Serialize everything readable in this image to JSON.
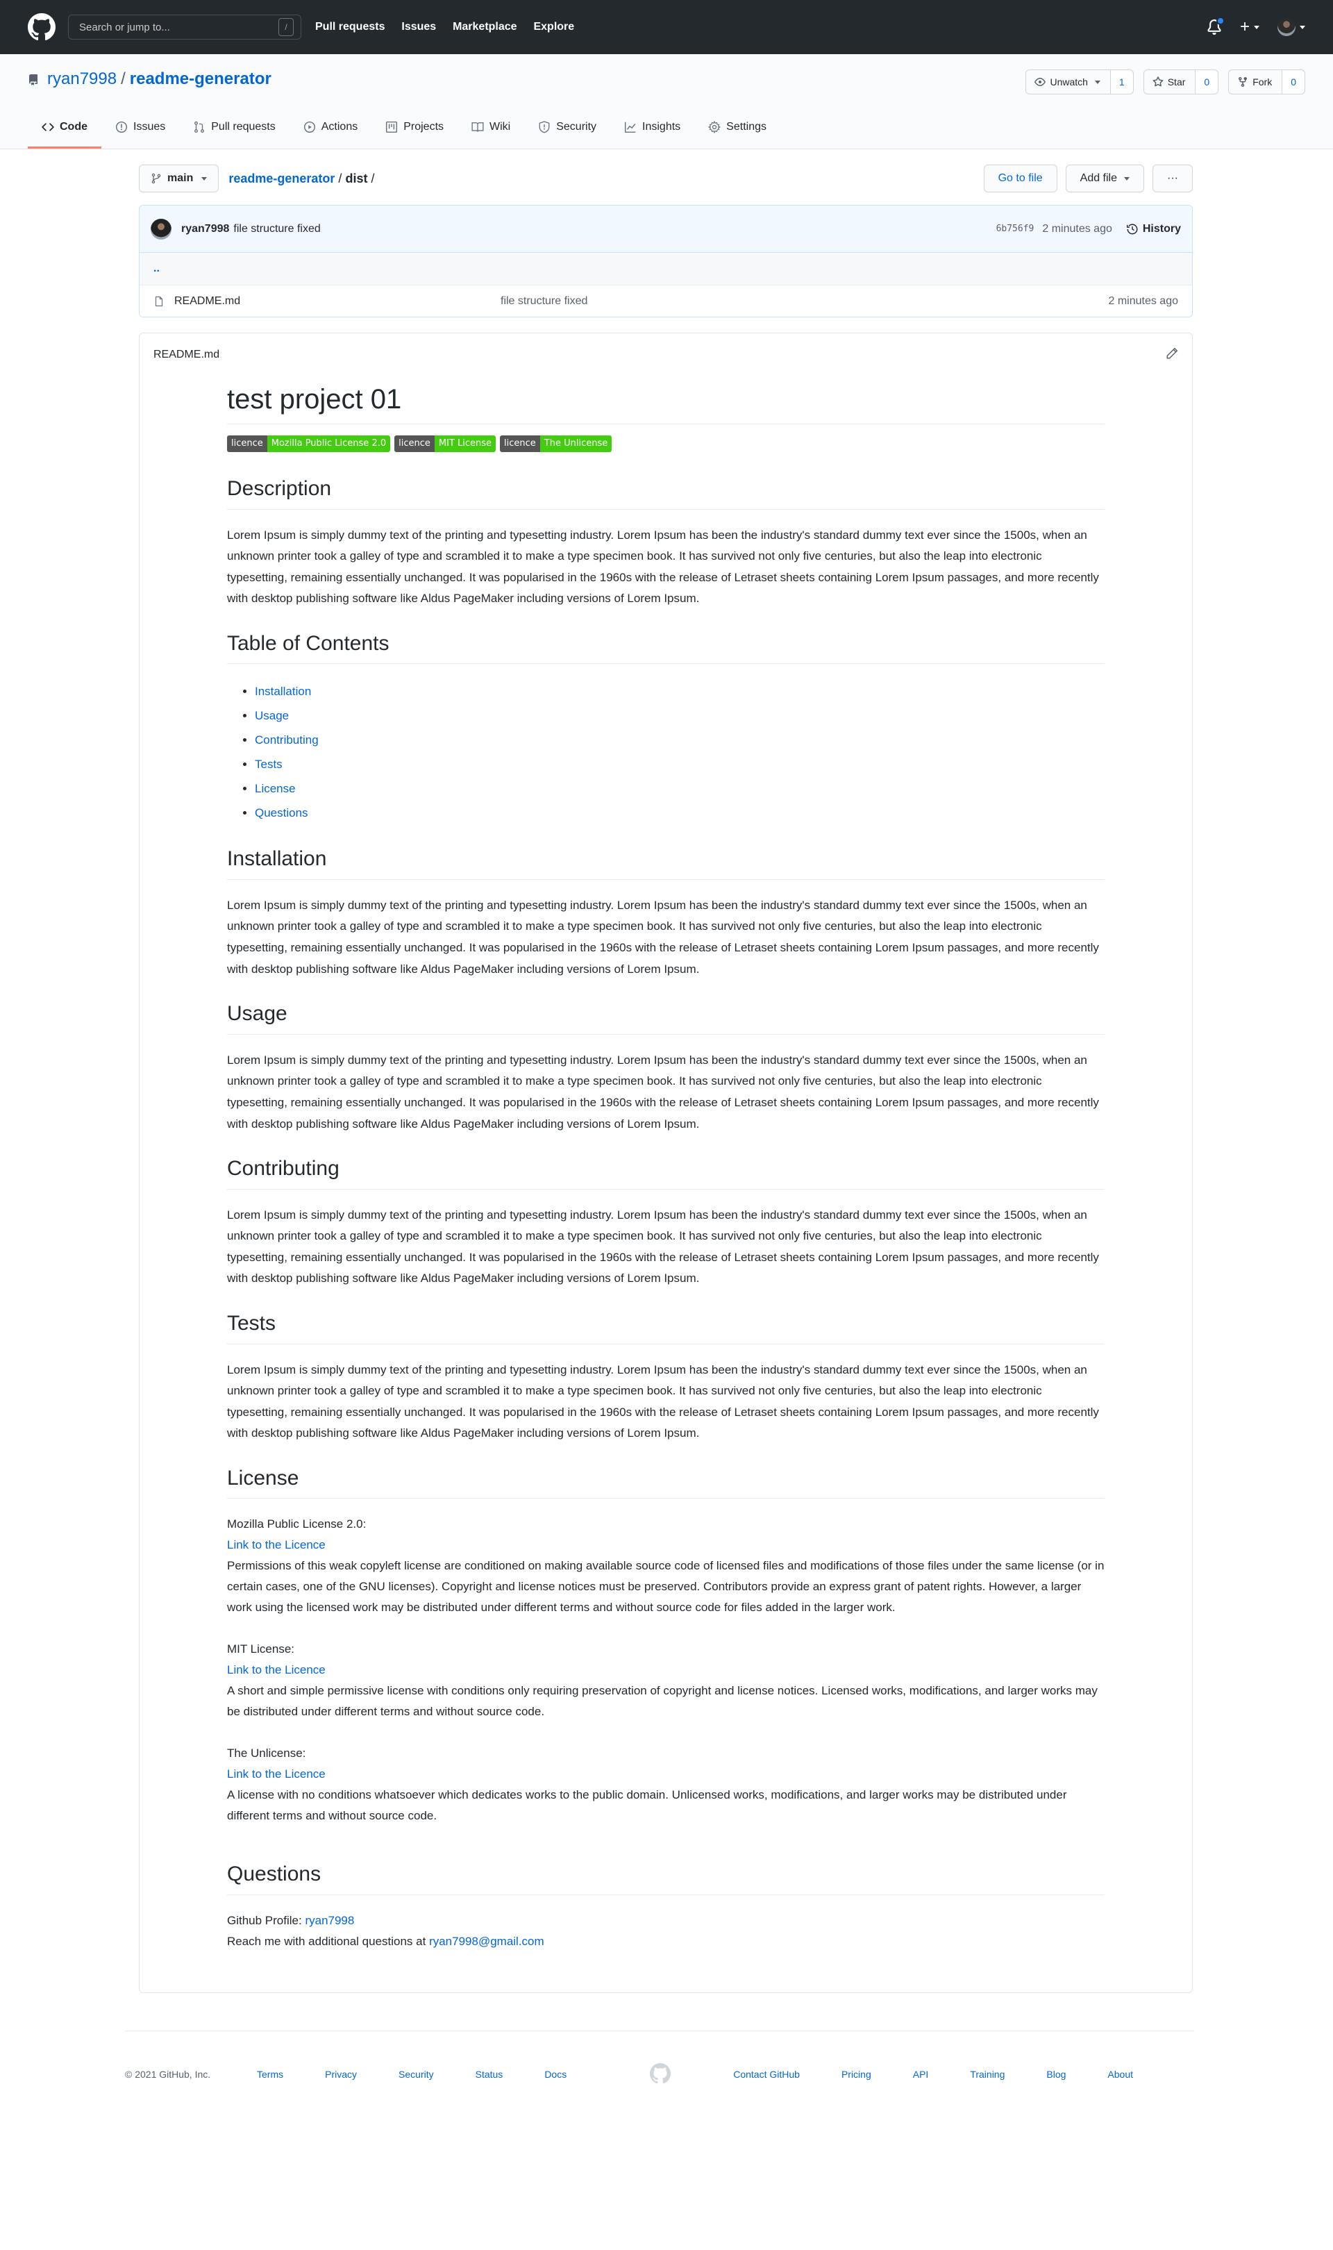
{
  "topbar": {
    "search_placeholder": "Search or jump to...",
    "search_shortcut": "/",
    "nav": [
      "Pull requests",
      "Issues",
      "Marketplace",
      "Explore"
    ]
  },
  "repo": {
    "owner": "ryan7998",
    "separator": "/",
    "name": "readme-generator",
    "watch": {
      "label": "Unwatch",
      "count": "1"
    },
    "star": {
      "label": "Star",
      "count": "0"
    },
    "fork": {
      "label": "Fork",
      "count": "0"
    },
    "tabs": [
      "Code",
      "Issues",
      "Pull requests",
      "Actions",
      "Projects",
      "Wiki",
      "Security",
      "Insights",
      "Settings"
    ],
    "active_tab": "Code"
  },
  "filenav": {
    "branch": "main",
    "crumb_repo": "readme-generator",
    "crumb_dir": "dist",
    "slash": "/",
    "go_to_file": "Go to file",
    "add_file": "Add file",
    "more": "···"
  },
  "commit": {
    "author": "ryan7998",
    "message": "file structure fixed",
    "sha": "6b756f9",
    "age": "2 minutes ago",
    "history": "History"
  },
  "files": {
    "up": "..",
    "rows": [
      {
        "name": "README.md",
        "message": "file structure fixed",
        "age": "2 minutes ago"
      }
    ]
  },
  "readme": {
    "filename": "README.md",
    "title": "test project 01",
    "badges": [
      {
        "label": "licence",
        "value": "Mozilla Public License 2.0"
      },
      {
        "label": "licence",
        "value": "MIT License"
      },
      {
        "label": "licence",
        "value": "The Unlicense"
      }
    ],
    "description_heading": "Description",
    "lorem": "Lorem Ipsum is simply dummy text of the printing and typesetting industry. Lorem Ipsum has been the industry's standard dummy text ever since the 1500s, when an unknown printer took a galley of type and scrambled it to make a type specimen book. It has survived not only five centuries, but also the leap into electronic typesetting, remaining essentially unchanged. It was popularised in the 1960s with the release of Letraset sheets containing Lorem Ipsum passages, and more recently with desktop publishing software like Aldus PageMaker including versions of Lorem Ipsum.",
    "toc_heading": "Table of Contents",
    "toc": [
      "Installation",
      "Usage",
      "Contributing",
      "Tests",
      "License",
      "Questions"
    ],
    "installation_heading": "Installation",
    "usage_heading": "Usage",
    "contributing_heading": "Contributing",
    "tests_heading": "Tests",
    "license_heading": "License",
    "licenses": [
      {
        "name": "Mozilla Public License 2.0:",
        "link": "Link to the Licence",
        "text": "Permissions of this weak copyleft license are conditioned on making available source code of licensed files and modifications of those files under the same license (or in certain cases, one of the GNU licenses). Copyright and license notices must be preserved. Contributors provide an express grant of patent rights. However, a larger work using the licensed work may be distributed under different terms and without source code for files added in the larger work."
      },
      {
        "name": "MIT License:",
        "link": "Link to the Licence",
        "text": "A short and simple permissive license with conditions only requiring preservation of copyright and license notices. Licensed works, modifications, and larger works may be distributed under different terms and without source code."
      },
      {
        "name": "The Unlicense:",
        "link": "Link to the Licence",
        "text": "A license with no conditions whatsoever which dedicates works to the public domain. Unlicensed works, modifications, and larger works may be distributed under different terms and without source code."
      }
    ],
    "questions_heading": "Questions",
    "profile_label": "Github Profile: ",
    "profile_link": "ryan7998",
    "reach_label": "Reach me with additional questions at ",
    "email": "ryan7998@gmail.com"
  },
  "footer": {
    "copyright": "© 2021 GitHub, Inc.",
    "left_links": [
      "Terms",
      "Privacy",
      "Security",
      "Status",
      "Docs"
    ],
    "right_links": [
      "Contact GitHub",
      "Pricing",
      "API",
      "Training",
      "Blog",
      "About"
    ]
  },
  "colors": {
    "topbar_bg": "#24292e",
    "link": "#0366d6",
    "active_tab_underline": "#f9826c",
    "badge_green": "#44cc11",
    "badge_gray": "#555555",
    "notification_dot": "#2188ff"
  }
}
